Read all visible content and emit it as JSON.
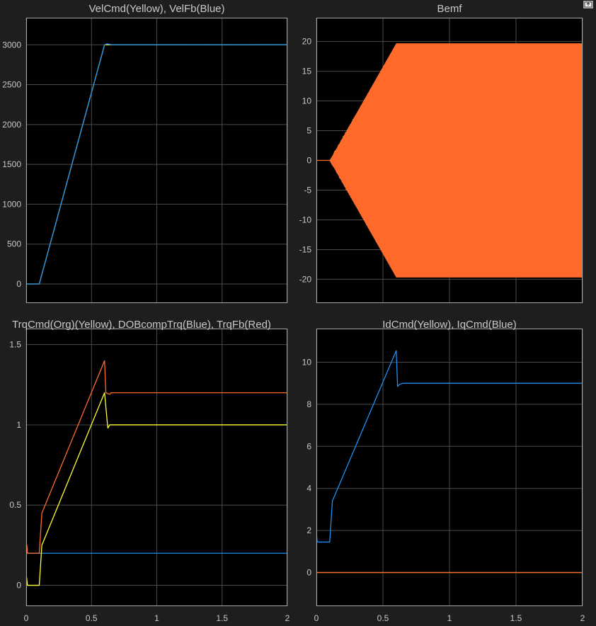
{
  "toolbar": {
    "export_icon": "export-axes-icon"
  },
  "colors": {
    "figure_bg": "#1e1e1e",
    "axes_bg": "#000000",
    "axis": "#a6a6a6",
    "grid": "#4a4a4a",
    "text": "#c8c8c8",
    "blue": "#1e8ff0",
    "orange": "#ff6a2b",
    "yellow": "#ffff33"
  },
  "chart_data": [
    {
      "id": "vel",
      "type": "line",
      "title": "VelCmd(Yellow), VelFb(Blue)",
      "xlabel": "",
      "ylabel": "",
      "xlim": [
        0,
        2
      ],
      "ylim": [
        -240,
        3340
      ],
      "xticks": [
        0,
        0.5,
        1,
        1.5,
        2
      ],
      "yticks": [
        0,
        500,
        1000,
        1500,
        2000,
        2500,
        3000
      ],
      "ytick_labels": [
        "0",
        "500",
        "1000",
        "1500",
        "2000",
        "2500",
        "3000"
      ],
      "show_xtick_labels": false,
      "grid": true,
      "series": [
        {
          "color": "yellow",
          "x": [
            0,
            0.1,
            0.6,
            2
          ],
          "y": [
            0,
            0,
            3000,
            3000
          ]
        },
        {
          "color": "blue",
          "x": [
            0,
            0.1,
            0.6,
            0.62,
            0.65,
            2
          ],
          "y": [
            0,
            0,
            3000,
            3012,
            3002,
            3000
          ]
        }
      ]
    },
    {
      "id": "bemf",
      "type": "line",
      "title": "Bemf",
      "xlabel": "",
      "ylabel": "",
      "xlim": [
        0,
        2
      ],
      "ylim": [
        -24,
        24
      ],
      "xticks": [
        0,
        0.5,
        1,
        1.5,
        2
      ],
      "yticks": [
        -20,
        -15,
        -10,
        -5,
        0,
        5,
        10,
        15,
        20
      ],
      "ytick_labels": [
        "-20",
        "-15",
        "-10",
        "-5",
        "0",
        "5",
        "10",
        "15",
        "20"
      ],
      "show_xtick_labels": false,
      "grid": true,
      "envelope": {
        "x": [
          0,
          0.1,
          0.6,
          2
        ],
        "amplitude": [
          0,
          0,
          19.7,
          19.7
        ]
      },
      "series": [
        {
          "color": "yellow",
          "phase": 0
        },
        {
          "color": "blue",
          "phase": 2.094
        },
        {
          "color": "orange",
          "phase": 4.189
        }
      ]
    },
    {
      "id": "trq",
      "type": "line",
      "title": "TrqCmd(Org)(Yellow), DOBcompTrq(Blue), TrqFb(Red)",
      "xlabel": "",
      "ylabel": "",
      "xlim": [
        0,
        2
      ],
      "ylim": [
        -0.13,
        1.6
      ],
      "xticks": [
        0,
        0.5,
        1,
        1.5,
        2
      ],
      "yticks": [
        0,
        0.5,
        1,
        1.5
      ],
      "ytick_labels": [
        "0",
        "0.5",
        "1",
        "1.5"
      ],
      "show_xtick_labels": false,
      "grid": true,
      "series": [
        {
          "color": "blue",
          "x": [
            0,
            0.005,
            0.01,
            2
          ],
          "y": [
            0.2,
            0.22,
            0.2,
            0.2
          ]
        },
        {
          "color": "orange",
          "x": [
            0,
            0.005,
            0.01,
            0.1,
            0.12,
            0.6,
            0.61,
            0.64,
            0.65,
            2
          ],
          "y": [
            0.2,
            0.25,
            0.2,
            0.2,
            0.45,
            1.4,
            1.2,
            1.19,
            1.2,
            1.2
          ]
        },
        {
          "color": "yellow",
          "x": [
            0,
            0.01,
            0.02,
            0.1,
            0.12,
            0.6,
            0.625,
            0.64,
            0.65,
            2
          ],
          "y": [
            0.07,
            0,
            0,
            0,
            0.25,
            1.2,
            0.98,
            1.0,
            1.0,
            1.0
          ]
        }
      ]
    },
    {
      "id": "idq",
      "type": "line",
      "title": "IdCmd(Yellow), IqCmd(Blue)",
      "xlabel": "",
      "ylabel": "",
      "xlim": [
        0,
        2
      ],
      "ylim": [
        -1.6,
        11.6
      ],
      "xticks": [
        0,
        0.5,
        1,
        1.5,
        2
      ],
      "xtick_labels": [
        "0",
        "0.5",
        "1",
        "1.5",
        "2"
      ],
      "yticks": [
        0,
        2,
        4,
        6,
        8,
        10
      ],
      "ytick_labels": [
        "0",
        "2",
        "4",
        "6",
        "8",
        "10"
      ],
      "show_xtick_labels": true,
      "grid": true,
      "series": [
        {
          "color": "yellow",
          "x": [
            0,
            2
          ],
          "y": [
            0,
            0
          ]
        },
        {
          "color": "orange",
          "x": [
            0,
            2
          ],
          "y": [
            0,
            0
          ]
        },
        {
          "color": "blue",
          "x": [
            0,
            0.005,
            0.01,
            0.1,
            0.12,
            0.6,
            0.61,
            0.625,
            0.65,
            2
          ],
          "y": [
            1.9,
            1.5,
            1.45,
            1.45,
            3.4,
            10.55,
            8.85,
            8.95,
            9.0,
            9.0
          ]
        }
      ]
    }
  ],
  "bottom_left_xtick_labels": [
    "0",
    "0.5",
    "1",
    "1.5",
    "2"
  ]
}
